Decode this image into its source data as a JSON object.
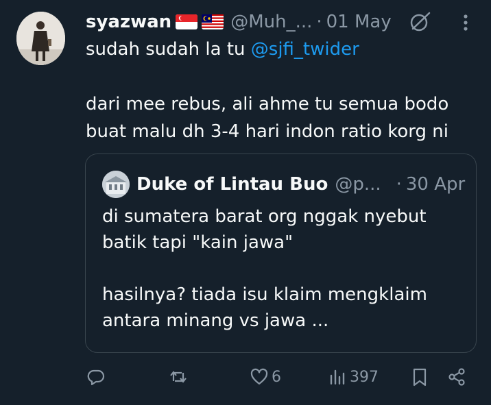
{
  "author": {
    "name": "syazwan",
    "flags": [
      "singapore-flag",
      "malaysia-flag"
    ],
    "handle": "@Muh_...",
    "separator": "·",
    "date": "01 May"
  },
  "tweet": {
    "line1_prefix": "sudah sudah la tu ",
    "mention": "@sjfi_twider",
    "line2": "dari mee rebus, ali ahme tu semua bodo",
    "line3": "buat malu dh 3-4 hari indon ratio korg ni"
  },
  "quoted": {
    "name": "Duke of Lintau Buo",
    "handle": "@p...",
    "separator": "·",
    "date": "30 Apr",
    "line1": "di sumatera barat org nggak nyebut",
    "line2": "batik tapi \"kain jawa\"",
    "line3": "hasilnya? tiada isu klaim mengklaim",
    "line4": "antara minang vs jawa ..."
  },
  "actions": {
    "reply_icon": "reply-icon",
    "retweet_icon": "retweet-icon",
    "like_icon": "heart-icon",
    "likes": "6",
    "views_icon": "views-icon",
    "views": "397",
    "bookmark_icon": "bookmark-icon",
    "share_icon": "share-icon"
  },
  "colors": {
    "background": "#15202b",
    "text": "#f7f9f9",
    "secondary": "#8b98a5",
    "accent": "#1d9bf0",
    "border": "#38444d"
  }
}
